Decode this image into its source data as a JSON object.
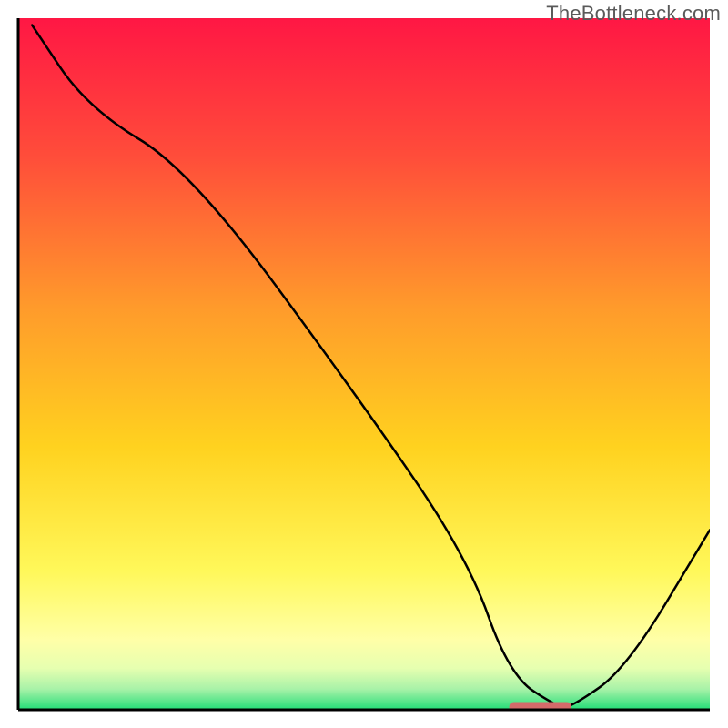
{
  "watermark": "TheBottleneck.com",
  "chart_data": {
    "type": "line",
    "title": "",
    "xlabel": "",
    "ylabel": "",
    "xlim": [
      0,
      100
    ],
    "ylim": [
      0,
      100
    ],
    "x": [
      2,
      10,
      25,
      50,
      65,
      71,
      78,
      80,
      88,
      100
    ],
    "values": [
      99,
      87,
      78,
      44,
      22,
      5,
      0.4,
      0.4,
      6,
      26
    ],
    "minimum_marker": {
      "x_start": 71,
      "x_end": 80,
      "y": 0.4
    },
    "gradient_stops": [
      {
        "offset": 0.0,
        "color": "#ff1744"
      },
      {
        "offset": 0.2,
        "color": "#ff4d3a"
      },
      {
        "offset": 0.42,
        "color": "#ff9b2b"
      },
      {
        "offset": 0.62,
        "color": "#ffd21f"
      },
      {
        "offset": 0.8,
        "color": "#fff85a"
      },
      {
        "offset": 0.9,
        "color": "#ffffa8"
      },
      {
        "offset": 0.94,
        "color": "#e6ffb0"
      },
      {
        "offset": 0.97,
        "color": "#a8f2a8"
      },
      {
        "offset": 1.0,
        "color": "#22dd77"
      }
    ],
    "axis_color": "#000000",
    "marker_color": "#d46a6a"
  }
}
